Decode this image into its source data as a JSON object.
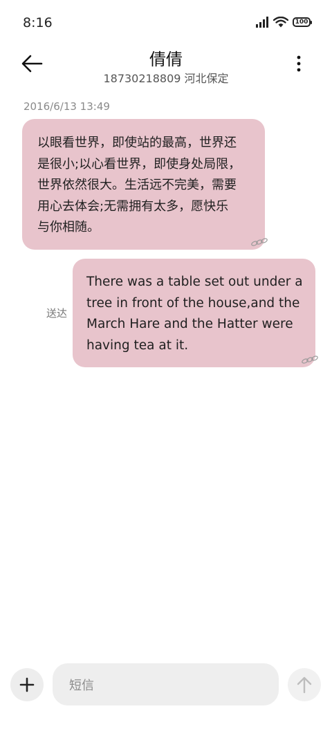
{
  "status_bar": {
    "time": "8:16",
    "battery": "100"
  },
  "header": {
    "contact_name": "倩倩",
    "contact_detail": "18730218809 河北保定"
  },
  "messages": [
    {
      "direction": "incoming",
      "timestamp": "2016/6/13 13:49",
      "lines": [
        "以眼看世界，即使站的最高，世界还",
        "是很小;以心看世界，即使身处局限，",
        "世界依然很大。生活远不完美，需要",
        "用心去体会;无需拥有太多，愿快乐",
        "与你相随。"
      ]
    },
    {
      "direction": "outgoing",
      "status": "送达",
      "lines": [
        "There was a table set out under a",
        "tree in front of the house,and the",
        "March Hare and the Hatter were",
        "having tea at it."
      ]
    }
  ],
  "composer": {
    "placeholder": "短信"
  },
  "colors": {
    "bubble": "#e8c4cc",
    "background": "#ffffff",
    "timestamp": "#8a8a8a"
  },
  "icons": [
    "signal-icon",
    "wifi-icon",
    "battery-icon",
    "back-arrow-icon",
    "more-vertical-icon",
    "chain-link-icon",
    "plus-icon",
    "send-arrow-icon"
  ]
}
